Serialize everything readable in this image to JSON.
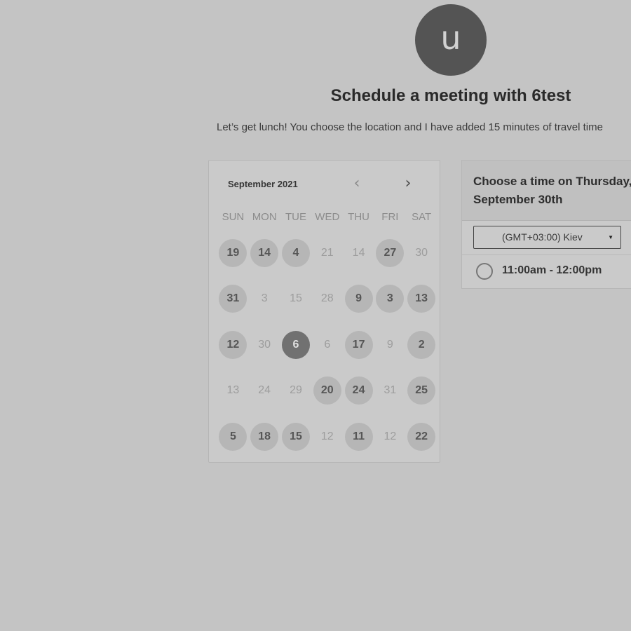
{
  "avatar": {
    "initial": "u"
  },
  "header": {
    "title": "Schedule a meeting with 6test",
    "subtitle": "Let’s get lunch! You choose the location and I have added 15 minutes of travel time"
  },
  "calendar": {
    "month": "September 2021",
    "prev_icon": "chevron-left-icon",
    "next_icon": "chevron-right-icon",
    "weekdays": [
      "SUN",
      "MON",
      "TUE",
      "WED",
      "THU",
      "FRI",
      "SAT"
    ],
    "weeks": [
      [
        {
          "d": "19",
          "s": "available"
        },
        {
          "d": "14",
          "s": "available"
        },
        {
          "d": "4",
          "s": "available"
        },
        {
          "d": "21",
          "s": "inactive"
        },
        {
          "d": "14",
          "s": "inactive"
        },
        {
          "d": "27",
          "s": "available"
        },
        {
          "d": "30",
          "s": "inactive"
        }
      ],
      [
        {
          "d": "31",
          "s": "available"
        },
        {
          "d": "3",
          "s": "inactive"
        },
        {
          "d": "15",
          "s": "inactive"
        },
        {
          "d": "28",
          "s": "inactive"
        },
        {
          "d": "9",
          "s": "available"
        },
        {
          "d": "3",
          "s": "available"
        },
        {
          "d": "13",
          "s": "available"
        }
      ],
      [
        {
          "d": "12",
          "s": "available"
        },
        {
          "d": "30",
          "s": "inactive"
        },
        {
          "d": "6",
          "s": "selected"
        },
        {
          "d": "6",
          "s": "inactive"
        },
        {
          "d": "17",
          "s": "available"
        },
        {
          "d": "9",
          "s": "inactive"
        },
        {
          "d": "2",
          "s": "available"
        }
      ],
      [
        {
          "d": "13",
          "s": "inactive"
        },
        {
          "d": "24",
          "s": "inactive"
        },
        {
          "d": "29",
          "s": "inactive"
        },
        {
          "d": "20",
          "s": "available"
        },
        {
          "d": "24",
          "s": "available"
        },
        {
          "d": "31",
          "s": "inactive"
        },
        {
          "d": "25",
          "s": "available"
        }
      ],
      [
        {
          "d": "5",
          "s": "available"
        },
        {
          "d": "18",
          "s": "available"
        },
        {
          "d": "15",
          "s": "available"
        },
        {
          "d": "12",
          "s": "inactive"
        },
        {
          "d": "11",
          "s": "available"
        },
        {
          "d": "12",
          "s": "inactive"
        },
        {
          "d": "22",
          "s": "available"
        }
      ]
    ]
  },
  "times": {
    "heading": "Choose a time on Thursday, September 30th",
    "timezone": "(GMT+03:00) Kiev",
    "timezone_icon": "caret-down-icon",
    "slots": [
      "11:00am - 12:00pm"
    ]
  },
  "colors": {
    "background": "#c4c4c4",
    "available_day": "#b6b6b6",
    "selected_day": "#717171"
  }
}
